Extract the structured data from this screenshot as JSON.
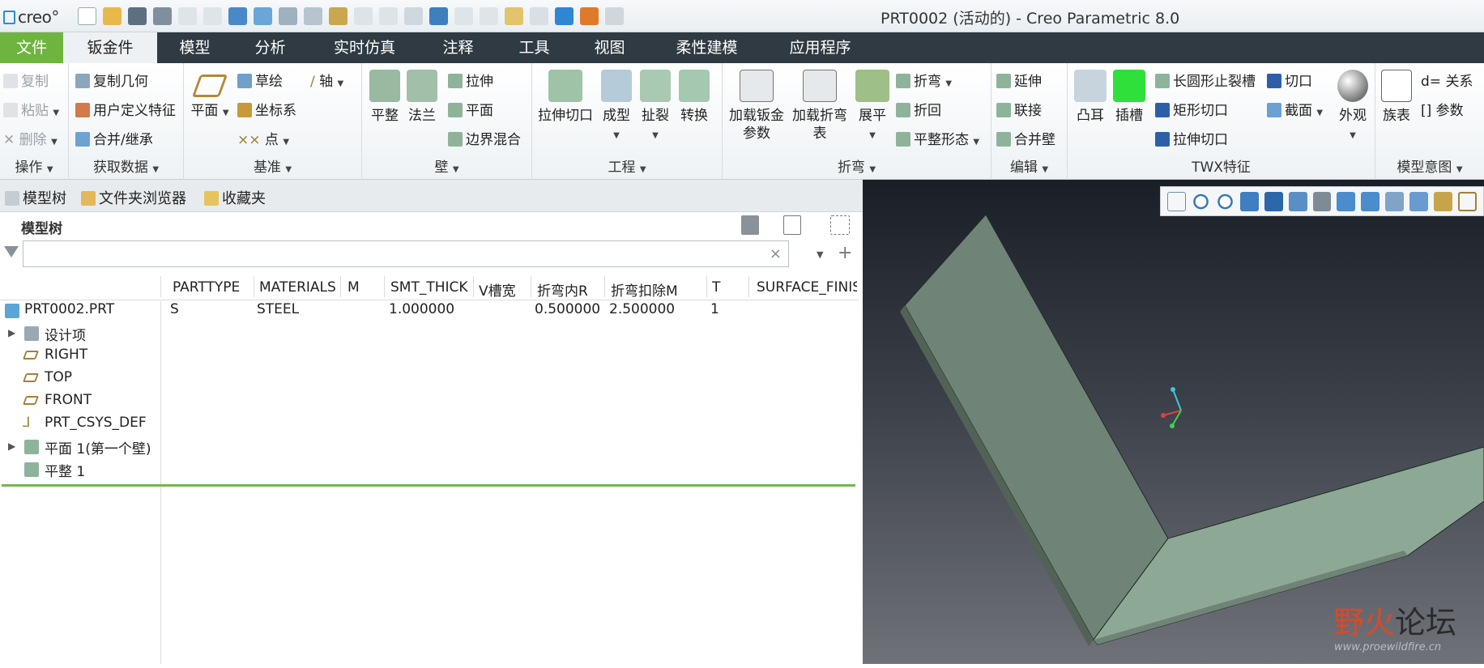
{
  "app": {
    "logo": "creo°",
    "window_title": "PRT0002 (活动的) - Creo Parametric 8.0"
  },
  "tabs": [
    {
      "label": "文件"
    },
    {
      "label": "钣金件"
    },
    {
      "label": "模型"
    },
    {
      "label": "分析"
    },
    {
      "label": "实时仿真"
    },
    {
      "label": "注释"
    },
    {
      "label": "工具"
    },
    {
      "label": "视图"
    },
    {
      "label": "柔性建模"
    },
    {
      "label": "应用程序"
    }
  ],
  "ribbon": {
    "ops": {
      "label": "操作",
      "copy": "复制",
      "paste": "粘贴",
      "delete": "删除"
    },
    "getdata": {
      "label": "获取数据",
      "copy_geom": "复制几何",
      "udf": "用户定义特征",
      "merge": "合并/继承"
    },
    "datum": {
      "label": "基准",
      "plane": "平面",
      "sketch": "草绘",
      "axis": "轴",
      "csys": "坐标系",
      "point": "点"
    },
    "wall": {
      "label": "壁",
      "flat": "平整",
      "flange": "法兰",
      "extrude": "拉伸",
      "planar": "平面",
      "blend": "边界混合"
    },
    "eng": {
      "label": "工程",
      "extrude_cut": "拉伸切口",
      "form": "成型",
      "rip": "扯裂",
      "convert": "转换"
    },
    "bend": {
      "label": "折弯",
      "load_params": "加载钣金参数",
      "load_table": "加载折弯表",
      "unbend": "展平",
      "bend": "折弯",
      "bend_back": "折回",
      "flat_state": "平整形态"
    },
    "edit": {
      "label": "编辑",
      "extend": "延伸",
      "join": "联接",
      "merge_wall": "合并壁"
    },
    "twx": {
      "label": "TWX特征",
      "boss": "凸耳",
      "slot": "插槽",
      "oblong_relief": "长圆形止裂槽",
      "rect_cut": "矩形切口",
      "ext_cut": "拉伸切口",
      "cut": "切口",
      "section": "截面",
      "appearance": "外观"
    },
    "intent": {
      "label": "模型意图",
      "family": "族表",
      "relations": "关系",
      "params": "参数"
    }
  },
  "navtabs": [
    "模型树",
    "文件夹浏览器",
    "收藏夹"
  ],
  "tree": {
    "header": "模型树",
    "search_placeholder": "",
    "columns": [
      "PARTTYPE",
      "MATERIALS",
      "M",
      "SMT_THICK",
      "V槽宽",
      "折弯内R",
      "折弯扣除M",
      "T",
      "SURFACE_FINIS"
    ],
    "root": {
      "name": "PRT0002.PRT",
      "values": [
        "S",
        "STEEL",
        "",
        "1.000000",
        "",
        "0.500000",
        "2.500000",
        "1",
        ""
      ]
    },
    "items": [
      {
        "name": "设计项",
        "expandable": true
      },
      {
        "name": "RIGHT",
        "expandable": false
      },
      {
        "name": "TOP",
        "expandable": false
      },
      {
        "name": "FRONT",
        "expandable": false
      },
      {
        "name": "PRT_CSYS_DEF",
        "expandable": false
      },
      {
        "name": "平面 1(第一个壁)",
        "expandable": true
      },
      {
        "name": "平整 1",
        "expandable": false
      }
    ]
  },
  "watermark": {
    "cn_red": "野火",
    "cn_dark": "论坛",
    "url": "www.proewildfire.cn"
  }
}
